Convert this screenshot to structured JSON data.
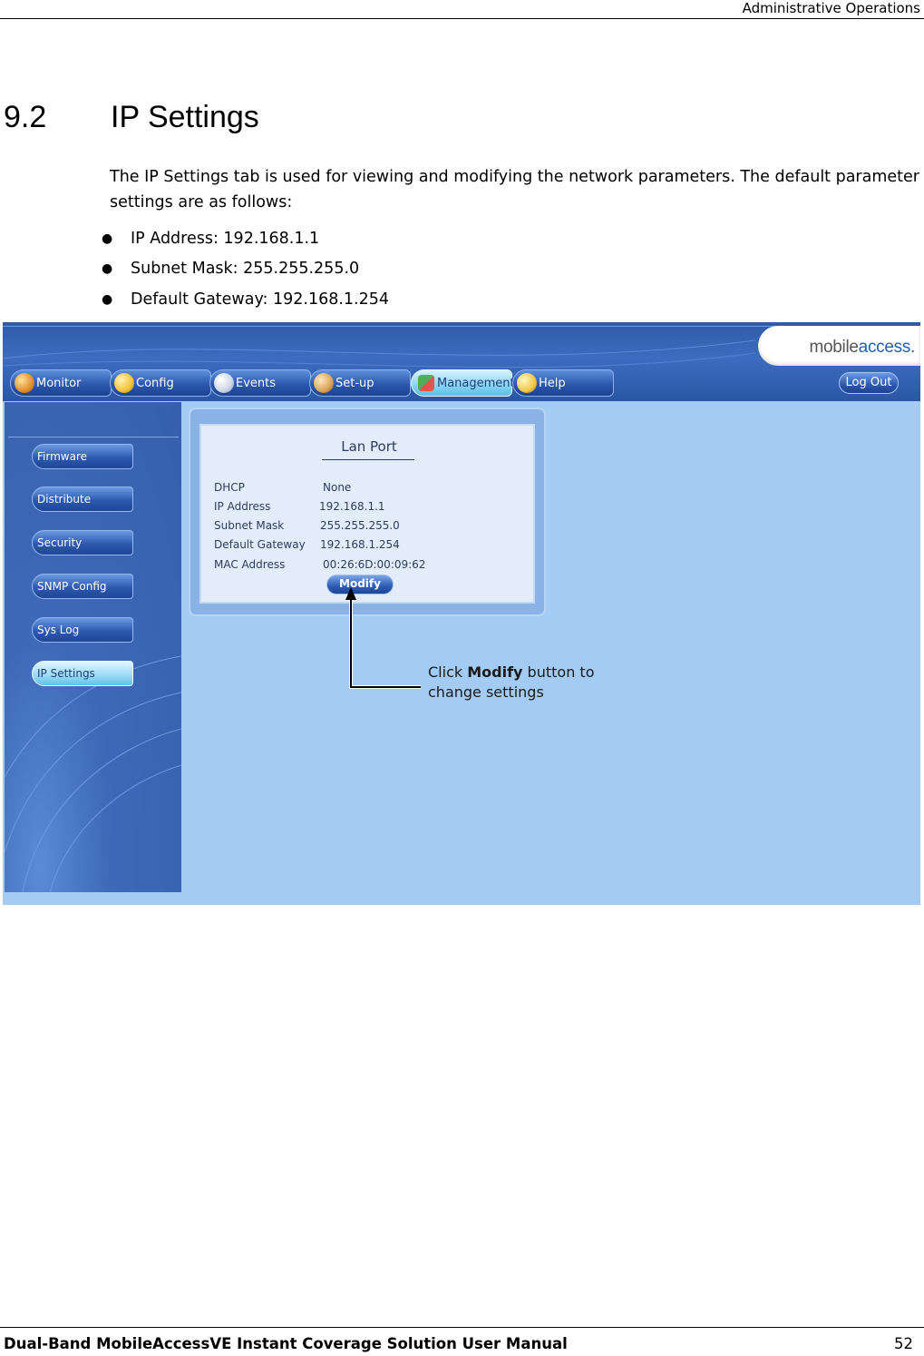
{
  "header": {
    "text": "Administrative Operations"
  },
  "section": {
    "number": "9.2",
    "title": "IP Settings",
    "intro": "The IP Settings tab is used for viewing and modifying the network parameters. The default parameter settings are as follows:",
    "defaults": [
      "IP Address: 192.168.1.1",
      "Subnet Mask: 255.255.255.0",
      "Default Gateway: 192.168.1.254"
    ]
  },
  "screenshot": {
    "logo": {
      "part1": "mobile",
      "part2": "access."
    },
    "tabs": [
      {
        "label": "Monitor",
        "icon": "monitor-icon",
        "color": "#e0902a"
      },
      {
        "label": "Config",
        "icon": "wrench-icon",
        "color": "#f2c23a"
      },
      {
        "label": "Events",
        "icon": "events-icon",
        "color": "#cfd7e6"
      },
      {
        "label": "Set-up",
        "icon": "hammer-icon",
        "color": "#d9a35a"
      },
      {
        "label": "Management",
        "icon": "management-icon",
        "color": "#4fae57"
      },
      {
        "label": "Help",
        "icon": "help-icon",
        "color": "#f0c84a"
      }
    ],
    "active_tab": "Management",
    "logout_label": "Log Out",
    "sidebar": [
      {
        "label": "Firmware"
      },
      {
        "label": "Distribute"
      },
      {
        "label": "Security"
      },
      {
        "label": "SNMP Config"
      },
      {
        "label": "Sys Log"
      },
      {
        "label": "IP Settings"
      }
    ],
    "active_sidebar": "IP Settings",
    "panel": {
      "title": "Lan Port",
      "fields": [
        {
          "label": "DHCP",
          "value": "None"
        },
        {
          "label": "IP Address",
          "value": "192.168.1.1"
        },
        {
          "label": "Subnet Mask",
          "value": "255.255.255.0"
        },
        {
          "label": "Default Gateway",
          "value": "192.168.1.254"
        },
        {
          "label": "MAC Address",
          "value": "00:26:6D:00:09:62"
        }
      ],
      "button_label": "Modify"
    },
    "callout": {
      "pre": "Click ",
      "bold": "Modify",
      "post": " button to",
      "line2": "change settings"
    }
  },
  "footer": {
    "title": "Dual-Band MobileAccessVE Instant Coverage Solution User Manual",
    "page": "52"
  }
}
